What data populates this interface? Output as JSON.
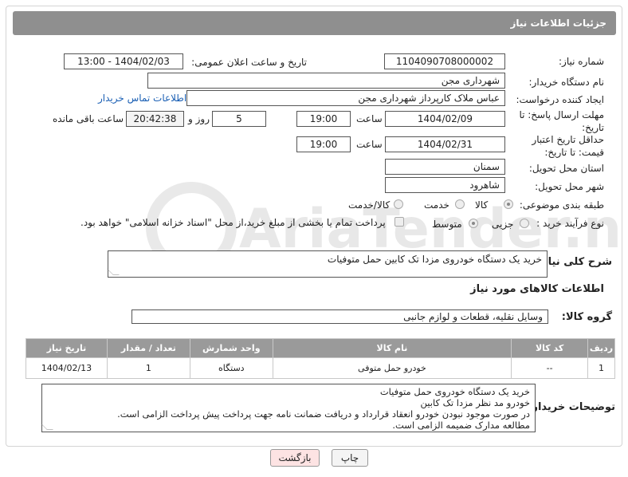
{
  "header": {
    "title": "جزئیات اطلاعات نیاز"
  },
  "fields": {
    "need_number_label": "شماره نیاز:",
    "need_number": "1104090708000002",
    "announce_label": "تاریخ و ساعت اعلان عمومی:",
    "announce_value": "1404/02/03 - 13:00",
    "buyer_org_label": "نام دستگاه خریدار:",
    "buyer_org": "شهرداری مجن",
    "creator_label": "ایجاد کننده درخواست:",
    "creator": "عباس ملاک کارپرداز شهرداری مجن",
    "contact_link": "اطلاعات تماس خریدار",
    "deadline_label": "مهلت ارسال پاسخ: تا تاریخ:",
    "deadline_date": "1404/02/09",
    "time_label": "ساعت",
    "deadline_time": "19:00",
    "days_value": "5",
    "days_label": "روز و",
    "remaining_value": "20:42:38",
    "remaining_label": "ساعت باقی مانده",
    "price_validity_label": "حداقل تاریخ اعتبار قیمت: تا تاریخ:",
    "price_date": "1404/02/31",
    "price_time": "19:00",
    "province_label": "استان محل تحویل:",
    "province": "سمنان",
    "city_label": "شهر محل تحویل:",
    "city": "شاهرود",
    "category_label": "طبقه بندی موضوعی:",
    "category_options": [
      "کالا",
      "خدمت",
      "کالا/خدمت"
    ],
    "process_label": "نوع فرآیند خرید :",
    "process_options": [
      "جزیی",
      "متوسط"
    ],
    "payment_note": "پرداخت تمام یا بخشی از مبلغ خرید،از محل \"اسناد خزانه اسلامی\" خواهد بود."
  },
  "summary": {
    "label": "شرح کلی نیاز:",
    "text": "خرید یک دستگاه خودروی مزدا تک کابین حمل متوفیات"
  },
  "goods": {
    "section_title": "اطلاعات کالاهای مورد نیاز",
    "group_label": "گروه کالا:",
    "group_value": "وسایل نقلیه، قطعات و لوازم جانبی",
    "columns": [
      "ردیف",
      "کد کالا",
      "نام کالا",
      "واحد شمارش",
      "تعداد / مقدار",
      "تاریخ نیاز"
    ],
    "rows": [
      [
        "1",
        "--",
        "خودرو حمل متوفی",
        "دستگاه",
        "1",
        "1404/02/13"
      ]
    ]
  },
  "buyer_notes": {
    "label": "توضیحات خریدار:",
    "lines": [
      "خرید یک دستگاه خودروی حمل متوفیات",
      "خودرو مد نظر مزدا تک کابین",
      "در صورت موجود نبودن خودرو انعقاد قرارداد و دریافت ضمانت نامه جهت پرداخت پیش پرداخت الزامی است.",
      "مطالعه مدارک ضمیمه الزامی است."
    ]
  },
  "buttons": {
    "print": "چاپ",
    "back": "بازگشت"
  },
  "watermark": {
    "text": "AriaTender.neT"
  },
  "colors": {
    "header_bg": "#8f8f8f",
    "table_header_bg": "#9a9a9a",
    "link": "#1a5fb4",
    "back_btn_bg": "#fde3e3"
  }
}
